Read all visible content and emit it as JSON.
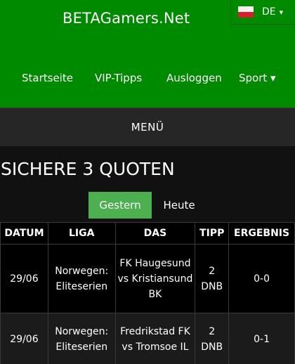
{
  "header": {
    "site_title": "BETAGamers.Net",
    "language": {
      "code": "DE",
      "caret": "▾",
      "flag_colors": [
        "#f2f2f2",
        "#d91f2e"
      ]
    }
  },
  "nav": {
    "items": [
      {
        "label": "Startseite"
      },
      {
        "label": "VIP-Tipps"
      },
      {
        "label": "Ausloggen"
      },
      {
        "label": "Sport ▾"
      }
    ]
  },
  "menu": {
    "label": "MENÜ"
  },
  "page": {
    "title": "SICHERE 3 QUOTEN"
  },
  "day_tabs": {
    "yesterday": "Gestern",
    "today": "Heute",
    "active": "Gestern"
  },
  "table": {
    "headers": [
      "DATUM",
      "LIGA",
      "DAS",
      "TIPP",
      "ERGEBNIS"
    ],
    "rows": [
      {
        "date": "29/06",
        "league": "Norwegen: Eliteserien",
        "match": "FK Haugesund vs Kristiansund BK",
        "tip": "2 DNB",
        "result": "0-0"
      },
      {
        "date": "29/06",
        "league": "Norwegen: Eliteserien",
        "match": "Fredrikstad FK vs Tromsoe IL",
        "tip": "2 DNB",
        "result": "0-1"
      }
    ]
  },
  "colors": {
    "topbar": "#008a00",
    "menu_bar": "#262626",
    "active_tab": "#4caf50",
    "background": "#111111"
  }
}
